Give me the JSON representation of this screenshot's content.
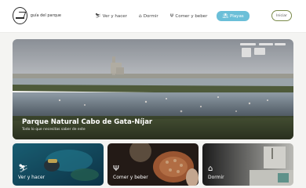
{
  "brand": {
    "name": "guía del parque",
    "icon": "park-logo-icon"
  },
  "nav": {
    "items": [
      {
        "label": "Ver y hacer",
        "icon": "hiker-icon"
      },
      {
        "label": "Dormir",
        "icon": "bed-icon"
      },
      {
        "label": "Comer y beber",
        "icon": "utensils-icon"
      },
      {
        "label": "Playas",
        "icon": "beach-icon",
        "active": true
      }
    ],
    "login_label": "Iniciar"
  },
  "hero": {
    "title": "Parque Natural Cabo de Gata-Níjar",
    "subtitle": "Todo lo que necesitas saber de este"
  },
  "cards": [
    {
      "label": "Ver y hacer",
      "icon": "hiker-icon"
    },
    {
      "label": "Comer y beber",
      "icon": "utensils-icon"
    },
    {
      "label": "Dormir",
      "icon": "bed-icon"
    }
  ],
  "colors": {
    "accent": "#6bbfd8",
    "login_border": "#7a8a4a"
  }
}
